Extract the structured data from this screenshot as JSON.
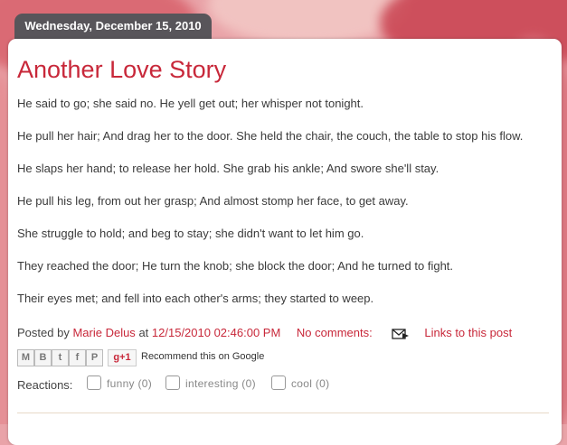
{
  "post": {
    "date_header": "Wednesday, December 15, 2010",
    "title": "Another Love Story",
    "paragraphs": [
      "He said to go; she said no. He yell get out; her whisper not tonight.",
      "He pull her hair; And drag her to the door. She held the chair, the couch, the table to stop his flow.",
      "He slaps her hand; to release her hold. She grab his ankle; And swore she'll stay.",
      "He pull his leg, from out her grasp; And almost stomp her face, to get away.",
      "She struggle to hold; and beg to stay; she didn't want to let him go.",
      "They reached the door; He turn the knob; she block the door; And he turned to fight.",
      "Their eyes met; and fell into each other's arms; they started to weep."
    ]
  },
  "footer": {
    "posted_by_label": "Posted by",
    "author": "Marie Delus",
    "at_label": "at",
    "timestamp": "12/15/2010 02:46:00 PM",
    "comments": "No comments:",
    "links": "Links to this post",
    "icons": [
      "email-post-icon"
    ]
  },
  "share": {
    "buttons": [
      "M",
      "B",
      "t",
      "f",
      "P"
    ],
    "gplus": "g+1",
    "recommend": "Recommend this on Google"
  },
  "reactions": {
    "label": "Reactions:",
    "options": [
      "funny (0)",
      "interesting (0)",
      "cool (0)"
    ]
  }
}
